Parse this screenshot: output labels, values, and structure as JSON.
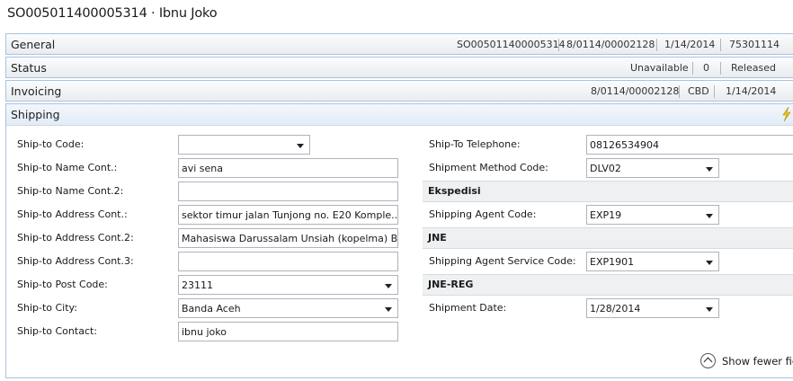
{
  "title": "SO005011400005314 · Ibnu Joko",
  "fasttabs": {
    "general": {
      "name": "General",
      "summary": [
        "SO005011400005314",
        "8/0114/00002128",
        "1/14/2014",
        "75301114"
      ]
    },
    "status": {
      "name": "Status",
      "summary": [
        "Unavailable",
        "0",
        "Released"
      ]
    },
    "invoicing": {
      "name": "Invoicing",
      "summary": [
        "8/0114/00002128",
        "CBD",
        "1/14/2014"
      ]
    },
    "shipping": {
      "name": "Shipping"
    }
  },
  "left_fields": [
    {
      "label": "Ship-to Code:",
      "value": "",
      "dropdown": true
    },
    {
      "label": "Ship-to Name Cont.:",
      "value": "avi sena",
      "dropdown": false
    },
    {
      "label": "Ship-to Name Cont.2:",
      "value": "",
      "dropdown": false
    },
    {
      "label": "Ship-to Address Cont.:",
      "value": "sektor timur jalan Tunjong no. E20 Komple...",
      "dropdown": false
    },
    {
      "label": "Ship-to Address Cont.2:",
      "value": "Mahasiswa Darussalam Unsiah (kopelma) B...",
      "dropdown": false
    },
    {
      "label": "Ship-to Address Cont.3:",
      "value": "",
      "dropdown": false
    },
    {
      "label": "Ship-to Post Code:",
      "value": "23111",
      "dropdown": true
    },
    {
      "label": "Ship-to City:",
      "value": "Banda Aceh",
      "dropdown": true
    },
    {
      "label": "Ship-to Contact:",
      "value": "ibnu joko",
      "dropdown": false
    }
  ],
  "right": {
    "telephone": {
      "label": "Ship-To Telephone:",
      "value": "08126534904"
    },
    "shipment_method": {
      "label": "Shipment Method Code:",
      "value": "DLV02"
    },
    "group1": "Ekspedisi",
    "agent": {
      "label": "Shipping Agent Code:",
      "value": "EXP19"
    },
    "group2": "JNE",
    "agent_service": {
      "label": "Shipping Agent Service Code:",
      "value": "EXP1901"
    },
    "group3": "JNE-REG",
    "shipment_date": {
      "label": "Shipment Date:",
      "value": "1/28/2014"
    }
  },
  "show_fewer": "Show fewer fiel",
  "colors": {
    "accent_border": "#a9c3de",
    "header_bg": "#e2ecf6"
  }
}
